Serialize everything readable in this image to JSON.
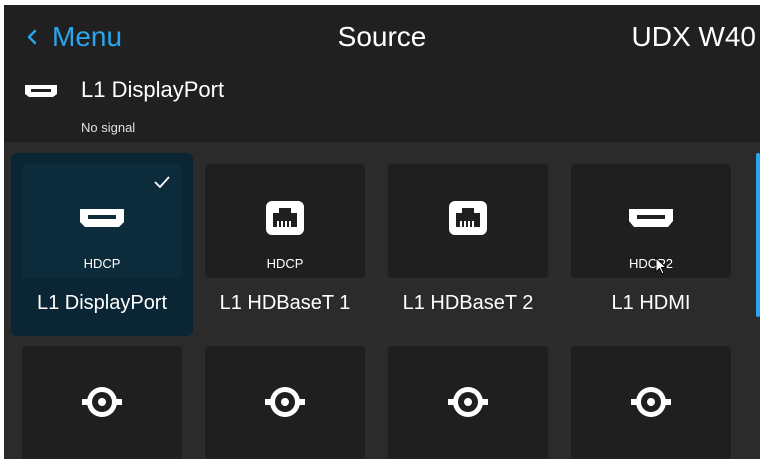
{
  "header": {
    "back_label": "Menu",
    "title": "Source",
    "device": "UDX W40"
  },
  "current": {
    "name": "L1 DisplayPort",
    "status": "No signal"
  },
  "sources": [
    {
      "label": "L1 DisplayPort",
      "tag": "HDCP",
      "icon": "displayport-icon",
      "selected": true
    },
    {
      "label": "L1 HDBaseT 1",
      "tag": "HDCP",
      "icon": "ethernet-port-icon",
      "selected": false
    },
    {
      "label": "L1 HDBaseT 2",
      "tag": "",
      "icon": "ethernet-port-icon",
      "selected": false
    },
    {
      "label": "L1 HDMI",
      "tag": "HDCP2",
      "icon": "hdmi-icon",
      "selected": false
    },
    {
      "icon": "sdi-connector-icon"
    },
    {
      "icon": "sdi-connector-icon"
    },
    {
      "icon": "sdi-connector-icon"
    },
    {
      "icon": "sdi-connector-icon"
    }
  ],
  "colors": {
    "accent": "#2aa6ee",
    "selected_tile": "#0c2c3c",
    "tile": "#1f1f1f",
    "background": "#2b2b2b",
    "header": "#202020"
  }
}
